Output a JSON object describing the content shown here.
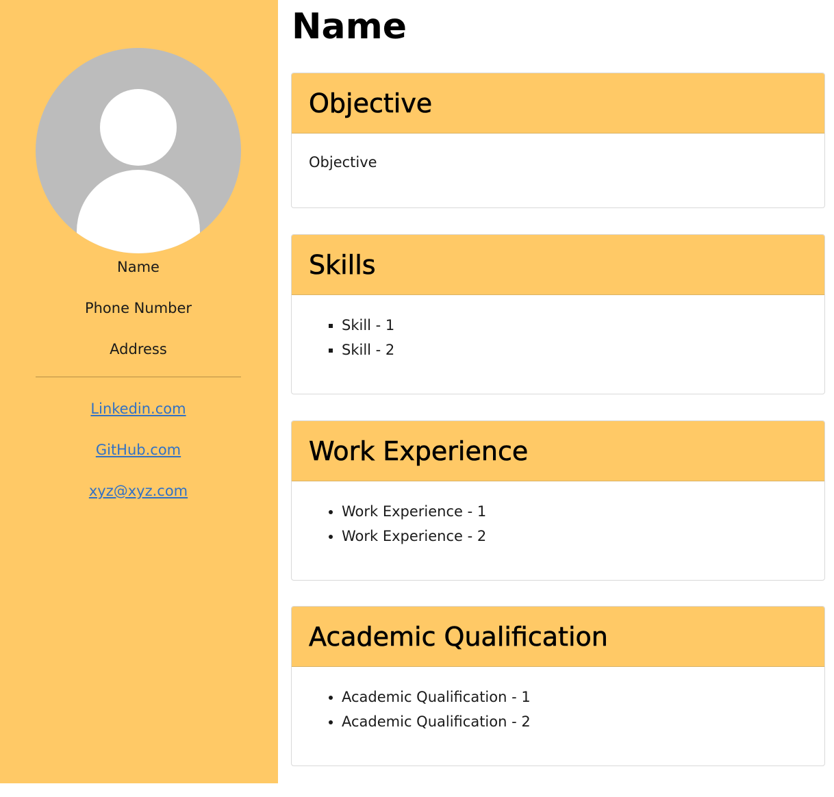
{
  "sidebar": {
    "avatar_icon": "user-avatar-icon",
    "name": "Name",
    "phone": "Phone Number",
    "address": "Address",
    "links": [
      {
        "label": "Linkedin.com"
      },
      {
        "label": "GitHub.com"
      },
      {
        "label": "xyz@xyz.com"
      }
    ]
  },
  "main": {
    "title": "Name",
    "sections": [
      {
        "heading": "Objective",
        "text": "Objective"
      },
      {
        "heading": "Skills",
        "items": [
          "Skill - 1",
          "Skill - 2"
        ]
      },
      {
        "heading": "Work Experience",
        "items": [
          "Work Experience - 1",
          "Work Experience - 2"
        ]
      },
      {
        "heading": "Academic Qualification",
        "items": [
          "Academic Qualification - 1",
          "Academic Qualification - 2"
        ]
      }
    ]
  },
  "colors": {
    "accent": "#ffc966",
    "avatar_bg": "#bcbcbc",
    "link": "#3271c4",
    "card_border": "#d9d9d9"
  }
}
